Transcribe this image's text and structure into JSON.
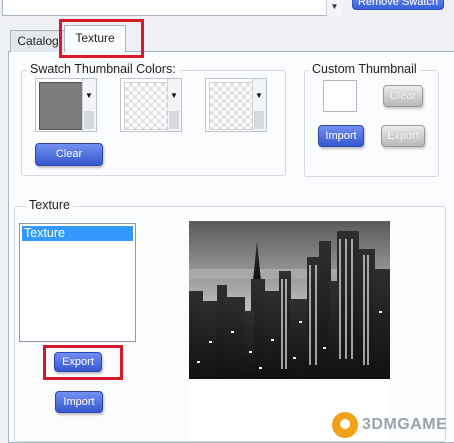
{
  "header": {
    "remove_swatch_label": "Remove Swatch"
  },
  "tabs": [
    {
      "label": "Catalog"
    },
    {
      "label": "Texture"
    }
  ],
  "swatch_colors": {
    "title": "Swatch Thumbnail Colors:",
    "swatches": [
      {
        "fill": "#7c7c7c"
      },
      {
        "fill": "transparent"
      },
      {
        "fill": "transparent"
      }
    ],
    "clear_label": "Clear"
  },
  "custom_thumbnail": {
    "title": "Custom Thumbnail",
    "clear_label": "Clear",
    "import_label": "Import",
    "export_label": "Export"
  },
  "texture": {
    "title": "Texture",
    "list_items": [
      "Texture"
    ],
    "export_label": "Export",
    "import_label": "Import"
  },
  "watermark": {
    "text": "3DMGAME"
  },
  "colors": {
    "accent_blue": "#3557cf",
    "highlight_red": "#d8192a",
    "selection_blue": "#3399ff"
  }
}
